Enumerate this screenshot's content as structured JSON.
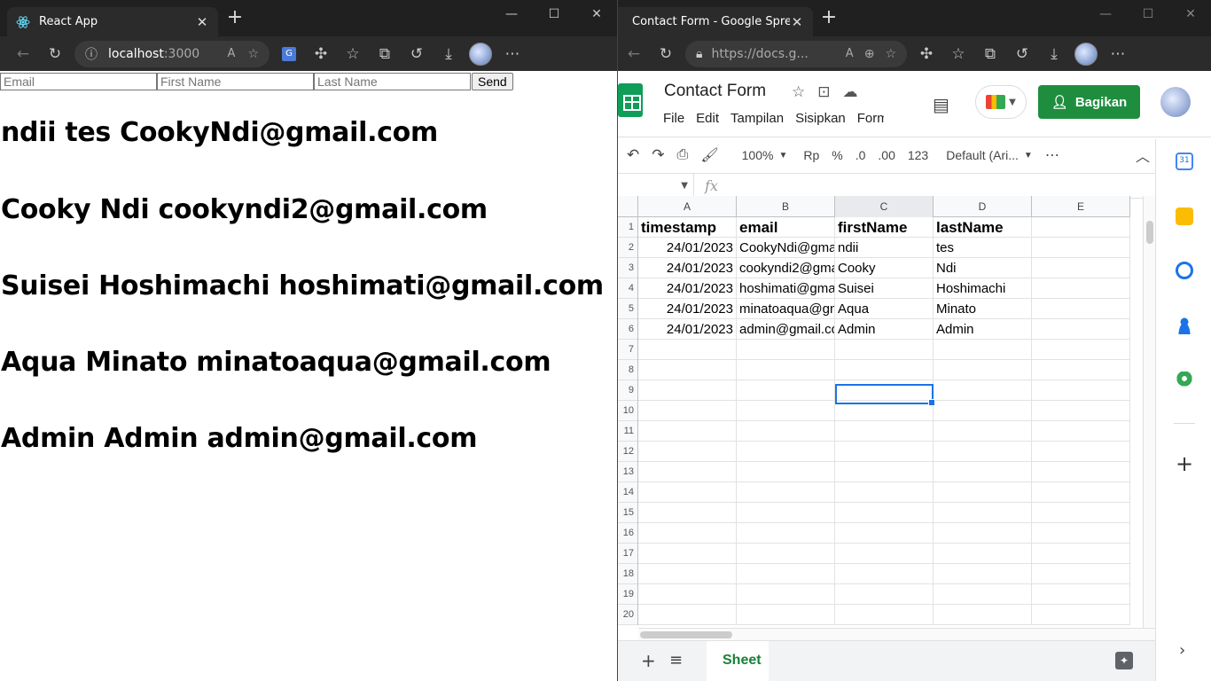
{
  "left_window": {
    "tab_title": "React App",
    "url_host": "localhost",
    "url_port": ":3000",
    "form": {
      "email_placeholder": "Email",
      "first_name_placeholder": "First Name",
      "last_name_placeholder": "Last Name",
      "send_label": "Send"
    },
    "entries": [
      "ndii tes CookyNdi@gmail.com",
      "Cooky Ndi cookyndi2@gmail.com",
      "Suisei Hoshimachi hoshimati@gmail.com",
      "Aqua Minato minatoaqua@gmail.com",
      "Admin Admin admin@gmail.com"
    ]
  },
  "right_window": {
    "tab_title": "Contact Form - Google Spreadsh",
    "url": "https://docs.g...",
    "doc_title": "Contact Form",
    "menus": [
      "File",
      "Edit",
      "Tampilan",
      "Sisipkan",
      "Form"
    ],
    "share_label": "Bagikan",
    "toolbar": {
      "zoom": "100%",
      "currency": "Rp",
      "percent": "%",
      "dec_less": ".0",
      "dec_more": ".00",
      "number_format": "123",
      "font": "Default (Ari..."
    },
    "fx_label": "fx",
    "columns": [
      "A",
      "B",
      "C",
      "D",
      "E"
    ],
    "row_numbers": [
      "1",
      "2",
      "3",
      "4",
      "5",
      "6",
      "7",
      "8",
      "9",
      "10",
      "11",
      "12",
      "13",
      "14",
      "15",
      "16",
      "17",
      "18",
      "19",
      "20"
    ],
    "table_header": [
      "timestamp",
      "email",
      "firstName",
      "lastName"
    ],
    "rows": [
      [
        "24/01/2023",
        "CookyNdi@gma",
        "ndii",
        "tes"
      ],
      [
        "24/01/2023",
        "cookyndi2@gma",
        "Cooky",
        "Ndi"
      ],
      [
        "24/01/2023",
        "hoshimati@gma",
        "Suisei",
        "Hoshimachi"
      ],
      [
        "24/01/2023",
        "minatoaqua@gn",
        "Aqua",
        "Minato"
      ],
      [
        "24/01/2023",
        "admin@gmail.co",
        "Admin",
        "Admin"
      ]
    ],
    "sheet_tab": "Sheet",
    "calendar_day": "31"
  },
  "colors": {
    "sheets_green": "#1e8e3e",
    "selection_blue": "#1a73e8",
    "browser_dark": "#202020"
  }
}
